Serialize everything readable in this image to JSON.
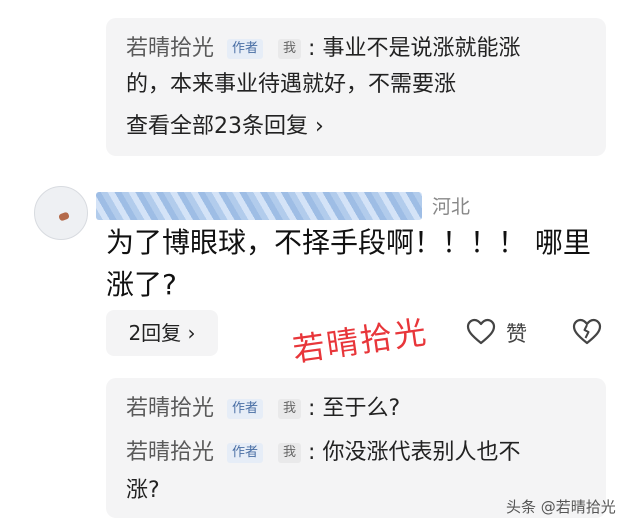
{
  "top_reply": {
    "author": "若晴拾光",
    "author_tag": "作者",
    "me_tag": "我",
    "text_line1": ": 事业不是说涨就能涨",
    "text_line2": "的，本来事业待遇就好，不需要涨",
    "view_all": "查看全部23条回复 ›"
  },
  "comment": {
    "location": "河北",
    "text_line1": "为了博眼球，不择手段啊！！！！ 哪里",
    "text_line2": "涨了?",
    "reply_button": "2回复 ›",
    "like_label": "赞"
  },
  "watermark_text": "若晴拾光",
  "sub_replies": [
    {
      "author": "若晴拾光",
      "author_tag": "作者",
      "me_tag": "我",
      "text": ": 至于么?"
    },
    {
      "author": "若晴拾光",
      "author_tag": "作者",
      "me_tag": "我",
      "text": ": 你没涨代表别人也不",
      "text_cont": "涨?"
    }
  ],
  "footer": "头条 @若晴拾光",
  "colors": {
    "accent_red": "#e8363a",
    "tag_author_bg": "#e6edf7",
    "panel_bg": "#f4f4f5"
  },
  "icons": {
    "like": "heart-outline-icon",
    "dislike": "broken-heart-icon"
  }
}
